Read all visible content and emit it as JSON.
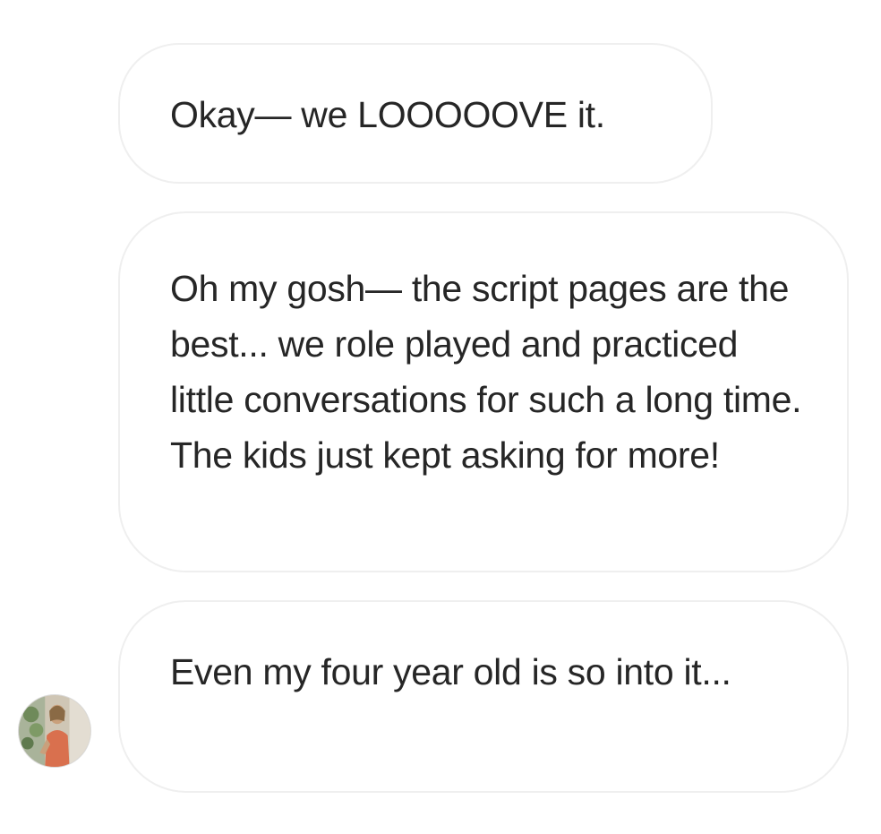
{
  "messages": [
    {
      "text": "Okay— we LOOOOOVE it."
    },
    {
      "text": "Oh my gosh— the script pages are the best... we role played and practiced little conversations for such a long time. The kids just kept asking for more!"
    },
    {
      "text": "Even my four year old is so into it..."
    }
  ],
  "avatar": {
    "icon": "user-avatar-photo"
  },
  "colors": {
    "bubble_border": "#efefef",
    "text": "#262626",
    "background": "#ffffff"
  }
}
